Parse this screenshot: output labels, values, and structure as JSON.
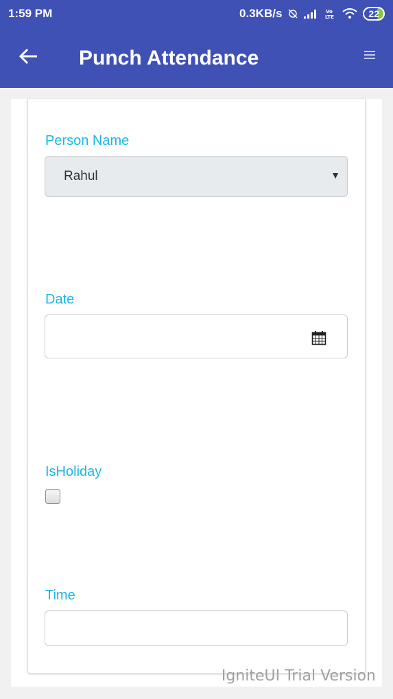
{
  "status_bar": {
    "time": "1:59 PM",
    "network_speed": "0.3KB/s",
    "battery_level": "22",
    "icons": [
      "alarm-off-icon",
      "signal-icon",
      "volte-icon",
      "wifi-icon",
      "battery-icon"
    ]
  },
  "app_bar": {
    "title": "Punch Attendance",
    "back_icon": "arrow-back-icon",
    "menu_icon": "menu-icon"
  },
  "form": {
    "person_name": {
      "label": "Person Name",
      "value": "Rahul"
    },
    "date": {
      "label": "Date",
      "value": "",
      "icon": "calendar-icon"
    },
    "is_holiday": {
      "label": "IsHoliday",
      "checked": false
    },
    "time": {
      "label": "Time",
      "value": ""
    }
  },
  "watermark": "IgniteUI Trial Version",
  "colors": {
    "primary": "#3f51b5",
    "label": "#1bb6e8",
    "select_bg": "#e8ebee"
  }
}
